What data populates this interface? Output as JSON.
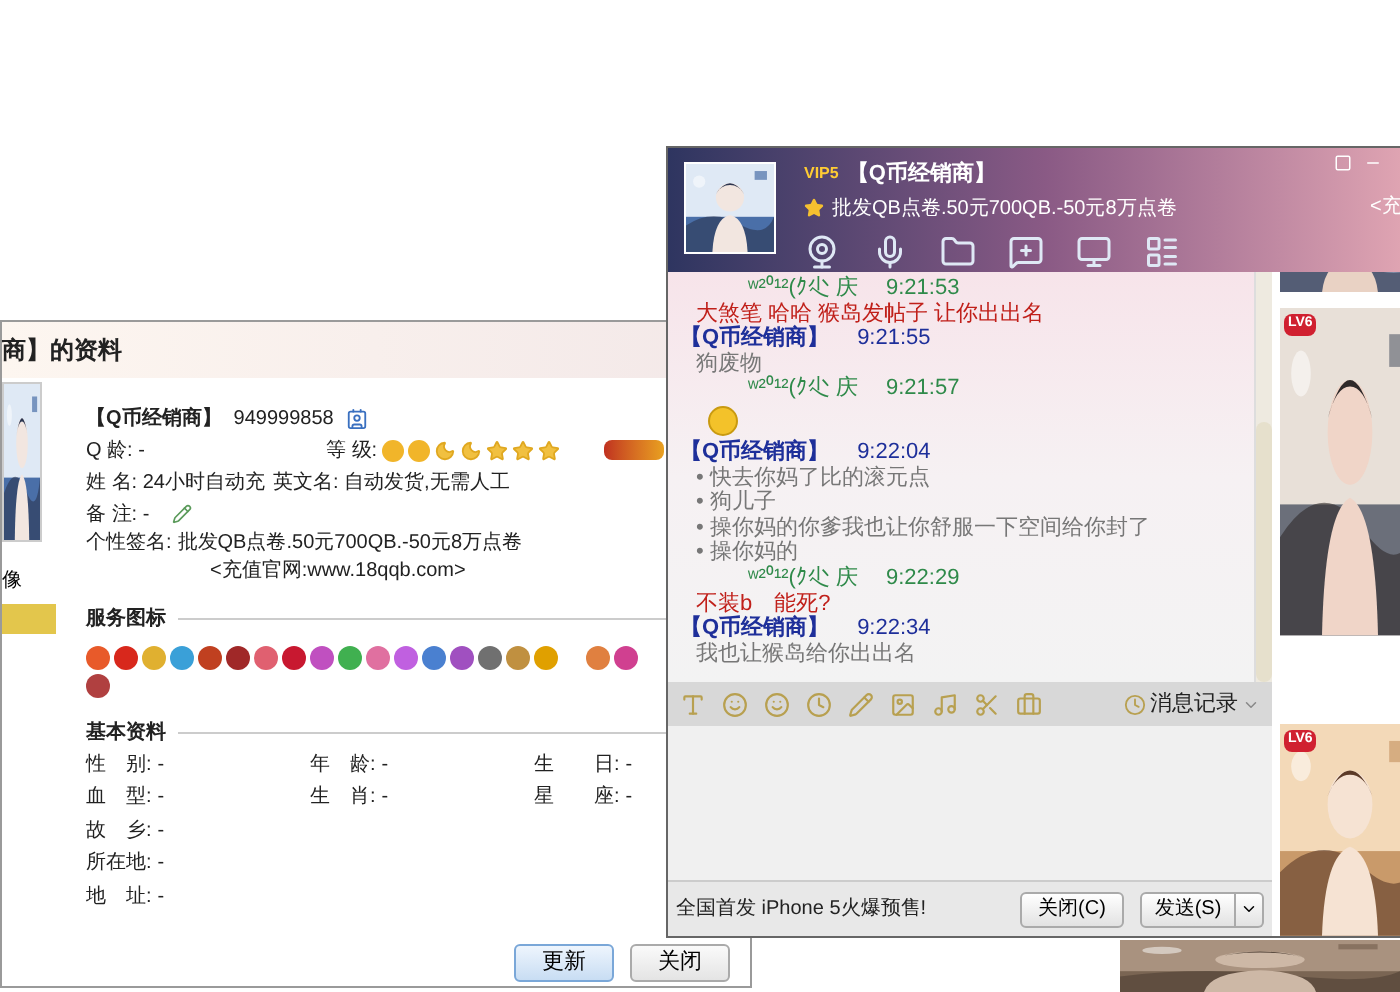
{
  "profile_window": {
    "title": "商】的资料",
    "avatar_caption": "像",
    "name": "【Q币经销商】",
    "qq_number": "949999858",
    "fields": [
      {
        "kind": "text",
        "text": "Q 龄: -"
      },
      {
        "kind": "level",
        "text": "等 级:"
      },
      {
        "kind": "text",
        "text": "姓 名: 24小时自动充"
      },
      {
        "kind": "text",
        "text": "英文名: 自动发货,无需人工"
      },
      {
        "kind": "text",
        "text": "备 注: -"
      }
    ],
    "signature_label": "个性签名:",
    "signature": "批发QB点卷.50元700QB.-50元8万点卷",
    "signature_line2": "<充值官网:www.18qqb.com>",
    "services_heading": "服务图标",
    "basic_heading": "基本资料",
    "basic_rows": [
      [
        {
          "label": "性　别:",
          "value": "-"
        },
        {
          "label": "年　龄:",
          "value": "-"
        },
        {
          "label": "生　　日:",
          "value": "-"
        }
      ],
      [
        {
          "label": "血　型:",
          "value": "-"
        },
        {
          "label": "生　肖:",
          "value": "-"
        },
        {
          "label": "星　　座:",
          "value": "-"
        }
      ],
      [
        {
          "label": "故　乡:",
          "value": "-"
        }
      ],
      [
        {
          "label": "所在地:",
          "value": "-"
        }
      ],
      [
        {
          "label": "地　址:",
          "value": "-"
        }
      ]
    ],
    "buttons": [
      {
        "label": "更新",
        "default": true
      },
      {
        "label": "关闭",
        "default": false
      }
    ]
  },
  "chat_window": {
    "vip": "VIP5",
    "name": "【Q币经销商】",
    "signature": "批发QB点卷.50元700QB.-50元8万点卷",
    "side_text": "<充",
    "messages": [
      {
        "kind": "peer",
        "sender": "ʷ²⁰¹²(ｸ尐 庆",
        "time": "9:21:53",
        "body": [
          {
            "kind": "text",
            "text": "大煞笔 哈哈 猴岛发帖子 让你出出名"
          }
        ]
      },
      {
        "kind": "self",
        "sender": "【Q币经销商】",
        "time": "9:21:55",
        "body": [
          {
            "kind": "text",
            "text": "狗废物"
          }
        ]
      },
      {
        "kind": "peer",
        "sender": "ʷ²⁰¹²(ｸ尐 庆",
        "time": "9:21:57",
        "body": [
          {
            "kind": "emoji"
          }
        ]
      },
      {
        "kind": "self",
        "sender": "【Q币经销商】",
        "time": "9:22:04",
        "body": [
          {
            "kind": "text",
            "text": "• 快去你妈了比的滚元点"
          },
          {
            "kind": "text",
            "text": "• 狗儿子"
          },
          {
            "kind": "text",
            "text": "• 操你妈的你爹我也让你舒服一下空间给你封了"
          },
          {
            "kind": "text",
            "text": "• 操你妈的"
          }
        ]
      },
      {
        "kind": "peer",
        "sender": "ʷ²⁰¹²(ｸ尐 庆",
        "time": "9:22:29",
        "body": [
          {
            "kind": "text",
            "text": "不装b　能死?"
          }
        ]
      },
      {
        "kind": "self",
        "sender": "【Q币经销商】",
        "time": "9:22:34",
        "body": [
          {
            "kind": "text",
            "text": "我也让猴岛给你出出名"
          }
        ]
      }
    ],
    "history_label": "消息记录",
    "ad_text": "全国首发 iPhone 5火爆预售!",
    "buttons": [
      {
        "label": "关闭(C)"
      },
      {
        "label": "发送(S)"
      }
    ],
    "side_badges": [
      "LV6",
      "LV6"
    ]
  }
}
